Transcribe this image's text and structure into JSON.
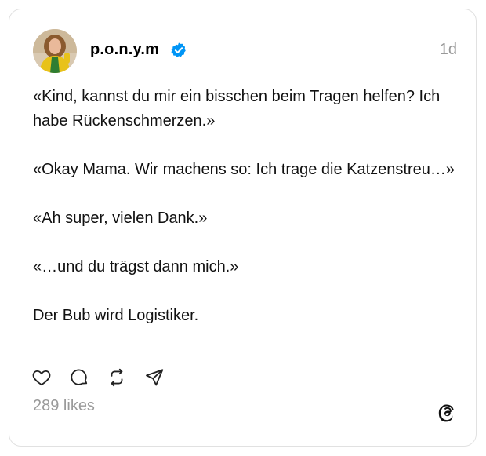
{
  "post": {
    "username": "p.o.n.y.m",
    "time_ago": "1d",
    "lines": [
      "«Kind, kannst du mir ein bisschen beim Tragen helfen? Ich habe Rückenschmerzen.»",
      "«Okay Mama. Wir machens so: Ich trage die Katzenstreu…»",
      "«Ah super, vielen Dank.»",
      "«…und du trägst dann mich.»",
      "Der Bub wird Logistiker."
    ],
    "likes": "289 likes"
  },
  "colors": {
    "verified": "#0095f6",
    "muted": "#999999",
    "avatar_jacket": "#e8c21a",
    "avatar_shirt": "#2e7d32"
  },
  "icons": [
    "heart-icon",
    "comment-icon",
    "repost-icon",
    "share-icon",
    "threads-logo-icon",
    "verified-badge-icon"
  ]
}
